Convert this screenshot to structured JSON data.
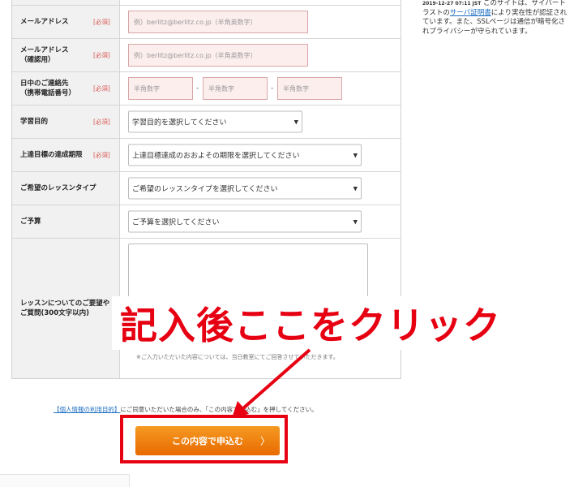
{
  "form": {
    "rows": {
      "email": {
        "label": "メールアドレス",
        "required": "[必須]",
        "placeholder": "例）berlitz@berlitz.co.jp（半角英数字）"
      },
      "email_confirm": {
        "label": "メールアドレス\n（確認用）",
        "required": "[必須]",
        "placeholder": "例）berlitz@berlitz.co.jp（半角英数字）"
      },
      "phone": {
        "label": "日中のご連絡先\n（携帯電話番号）",
        "required": "[必須]",
        "placeholder_1": "半角数字",
        "placeholder_2": "半角数字",
        "placeholder_3": "半角数字",
        "separator": "-"
      },
      "purpose": {
        "label": "学習目的",
        "required": "[必須]",
        "value": "学習目的を選択してください"
      },
      "deadline": {
        "label": "上達目標の達成期限",
        "required": "[必須]",
        "value": "上達目標達成のおおよその期限を選択してください"
      },
      "lesson_type": {
        "label": "ご希望のレッスンタイプ",
        "value": "ご希望のレッスンタイプを選択してください"
      },
      "budget": {
        "label": "ご予算",
        "value": "ご予算を選択してください"
      },
      "request": {
        "label": "レッスンについてのご要望や\nご質問(300文字以内)",
        "note": "※ご入力いただいた内容については、当日教室にてご回答させていただきます。"
      }
    }
  },
  "sidebar": {
    "date": "2019-12-27 07:11 JST",
    "text_before": "このサイトは、サイバートラストの",
    "link": "サーバ証明書",
    "text_after": "により実在性が認証されています。また、SSLページは通信が暗号化されプライバシーが守られています。"
  },
  "consent": {
    "link": "【個人情報の利用目的】",
    "text": "にご同意いただいた場合のみ、「この内容で申込む」を押してください。"
  },
  "submit": {
    "label": "この内容で申込む",
    "chevron": "〉"
  },
  "annotation": {
    "text": "記入後ここをクリック"
  },
  "colors": {
    "accent": "#e60012",
    "button": "#f08300",
    "link": "#1a6ec2"
  }
}
